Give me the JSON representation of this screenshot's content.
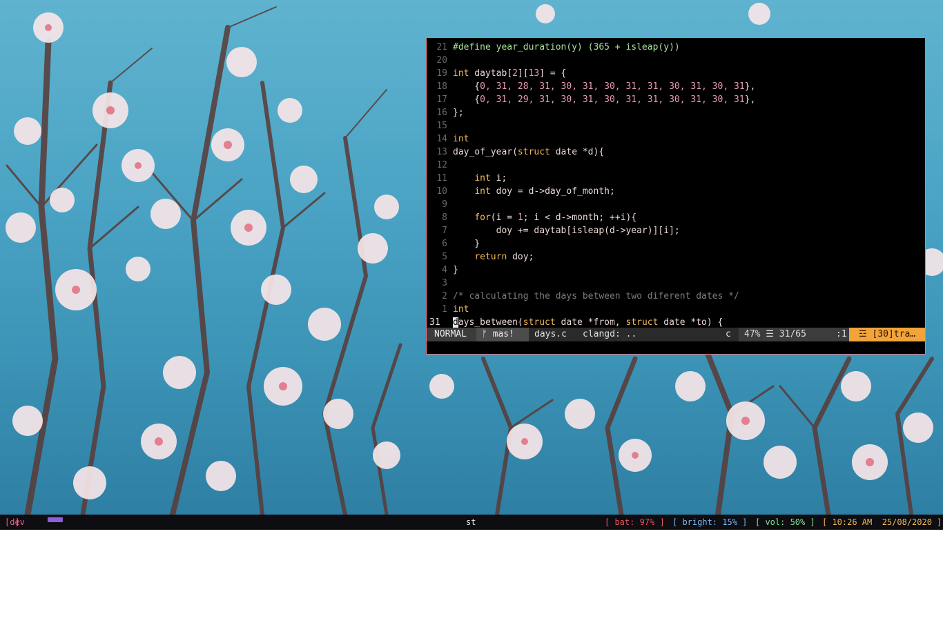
{
  "wallpaper": {
    "description_icon": "cherry-blossom-wallpaper",
    "sky_color": "#4aa3c4"
  },
  "editor": {
    "lines": [
      {
        "num": "21",
        "parts": [
          {
            "t": "pp",
            "v": "#define year_duration(y) (365 + isleap(y))"
          }
        ]
      },
      {
        "num": "20",
        "parts": []
      },
      {
        "num": "19",
        "parts": [
          {
            "t": "kw",
            "v": "int"
          },
          {
            "t": "",
            "v": " daytab["
          },
          {
            "t": "num",
            "v": "2"
          },
          {
            "t": "",
            "v": "]["
          },
          {
            "t": "num",
            "v": "13"
          },
          {
            "t": "",
            "v": "] = {"
          }
        ]
      },
      {
        "num": "18",
        "parts": [
          {
            "t": "",
            "v": "    {"
          },
          {
            "t": "num",
            "v": "0, 31, 28, 31, 30, 31, 30, 31, 31, 30, 31, 30, 31"
          },
          {
            "t": "",
            "v": "},"
          }
        ]
      },
      {
        "num": "17",
        "parts": [
          {
            "t": "",
            "v": "    {"
          },
          {
            "t": "num",
            "v": "0, 31, 29, 31, 30, 31, 30, 31, 31, 30, 31, 30, 31"
          },
          {
            "t": "",
            "v": "},"
          }
        ]
      },
      {
        "num": "16",
        "parts": [
          {
            "t": "",
            "v": "};"
          }
        ]
      },
      {
        "num": "15",
        "parts": []
      },
      {
        "num": "14",
        "parts": [
          {
            "t": "kw",
            "v": "int"
          }
        ]
      },
      {
        "num": "13",
        "parts": [
          {
            "t": "",
            "v": "day_of_year("
          },
          {
            "t": "kw",
            "v": "struct"
          },
          {
            "t": "",
            "v": " date *d){"
          }
        ]
      },
      {
        "num": "12",
        "parts": []
      },
      {
        "num": "11",
        "parts": [
          {
            "t": "",
            "v": "    "
          },
          {
            "t": "kw",
            "v": "int"
          },
          {
            "t": "",
            "v": " i;"
          }
        ]
      },
      {
        "num": "10",
        "parts": [
          {
            "t": "",
            "v": "    "
          },
          {
            "t": "kw",
            "v": "int"
          },
          {
            "t": "",
            "v": " doy = d->day_of_month;"
          }
        ]
      },
      {
        "num": "9",
        "parts": []
      },
      {
        "num": "8",
        "parts": [
          {
            "t": "",
            "v": "    "
          },
          {
            "t": "kw",
            "v": "for"
          },
          {
            "t": "",
            "v": "(i = "
          },
          {
            "t": "num",
            "v": "1"
          },
          {
            "t": "",
            "v": "; i < d->month; ++i){"
          }
        ]
      },
      {
        "num": "7",
        "parts": [
          {
            "t": "",
            "v": "        doy += daytab[isleap(d->year)][i];"
          }
        ]
      },
      {
        "num": "6",
        "parts": [
          {
            "t": "",
            "v": "    }"
          }
        ]
      },
      {
        "num": "5",
        "parts": [
          {
            "t": "",
            "v": "    "
          },
          {
            "t": "kw",
            "v": "return"
          },
          {
            "t": "",
            "v": " doy;"
          }
        ]
      },
      {
        "num": "4",
        "parts": [
          {
            "t": "",
            "v": "}"
          }
        ]
      },
      {
        "num": "3",
        "parts": []
      },
      {
        "num": "2",
        "parts": [
          {
            "t": "cm",
            "v": "/* calculating the days between two diferent dates */"
          }
        ]
      },
      {
        "num": "1",
        "parts": [
          {
            "t": "kw",
            "v": "int"
          }
        ]
      },
      {
        "num": "31",
        "current": true,
        "parts": [
          {
            "t": "cursor",
            "v": "d"
          },
          {
            "t": "",
            "v": "ays_between("
          },
          {
            "t": "kw",
            "v": "struct"
          },
          {
            "t": "",
            "v": " date *from, "
          },
          {
            "t": "kw",
            "v": "struct"
          },
          {
            "t": "",
            "v": " date *to) {"
          }
        ]
      }
    ],
    "statusline": {
      "mode": "NORMAL",
      "branch": "ᚠ mas!",
      "file": "days.c",
      "lsp": "clangd: ..",
      "filetype": "c",
      "position": "47% ☰ 31/65",
      "column": ":1",
      "warning": "☲ [30]tra…"
    }
  },
  "bar": {
    "workspace_open": "[",
    "workspace": "dev",
    "workspace_close": "]",
    "indicator": "▀▀▀",
    "window_title": "st",
    "battery": "[ bat: 97% ]",
    "brightness": "[ bright: 15% ]",
    "volume": "[ vol: 50% ]",
    "datetime": "[ 10:26 AM  25/08/2020 ]"
  }
}
